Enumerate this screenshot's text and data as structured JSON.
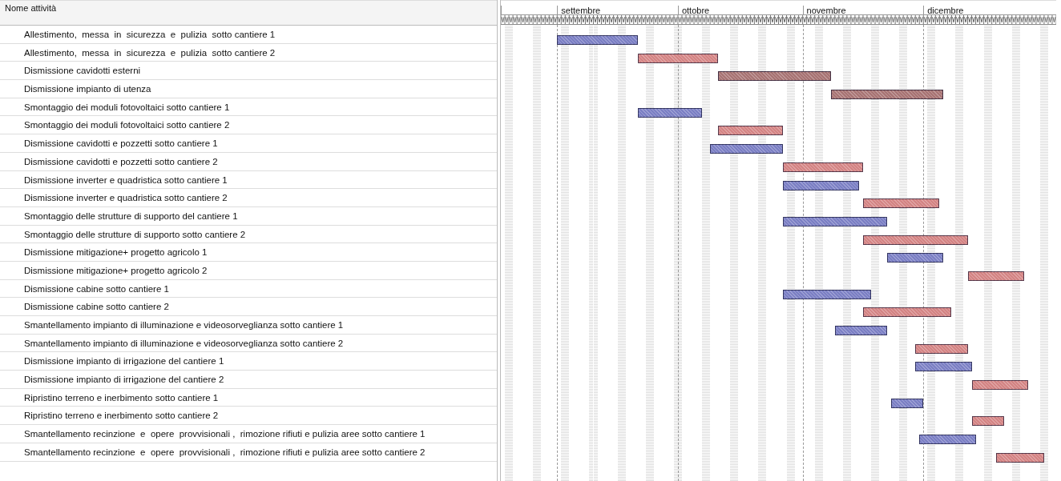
{
  "table": {
    "column_header": "Nome attività"
  },
  "timeline": {
    "months": [
      {
        "label": "settembre"
      },
      {
        "label": "ottobre"
      },
      {
        "label": "novembre"
      },
      {
        "label": "dicembre"
      }
    ]
  },
  "tasks": [
    {
      "name": "Allestimento,  messa  in  sicurezza  e  pulizia  sotto cantiere 1",
      "color": "#7b7fc4"
    },
    {
      "name": "Allestimento,  messa  in  sicurezza  e  pulizia  sotto cantiere 2",
      "color": "#d48484"
    },
    {
      "name": "Dismissione cavidotti esterni",
      "color": "#a87474"
    },
    {
      "name": "Dismissione impianto di utenza",
      "color": "#a87474"
    },
    {
      "name": "Smontaggio dei moduli fotovoltaici sotto cantiere 1",
      "color": "#7b7fc4"
    },
    {
      "name": "Smontaggio dei moduli fotovoltaici sotto cantiere 2",
      "color": "#d48484"
    },
    {
      "name": "Dismissione cavidotti e pozzetti sotto cantiere 1",
      "color": "#7b7fc4"
    },
    {
      "name": "Dismissione cavidotti e pozzetti sotto cantiere 2",
      "color": "#d48484"
    },
    {
      "name": "Dismissione inverter e quadristica sotto cantiere 1",
      "color": "#7b7fc4"
    },
    {
      "name": "Dismissione inverter e quadristica sotto cantiere 2",
      "color": "#d48484"
    },
    {
      "name": "Smontaggio delle strutture di supporto del cantiere 1",
      "color": "#7b7fc4"
    },
    {
      "name": "Smontaggio delle strutture di supporto sotto cantiere 2",
      "color": "#d48484"
    },
    {
      "name": "Dismissione mitigazione+ progetto agricolo 1",
      "color": "#7b7fc4"
    },
    {
      "name": "Dismissione mitigazione+ progetto agricolo 2",
      "color": "#d48484"
    },
    {
      "name": "Dismissione cabine sotto cantiere 1",
      "color": "#7b7fc4"
    },
    {
      "name": "Dismissione cabine sotto cantiere 2",
      "color": "#d48484"
    },
    {
      "name": "Smantellamento impianto di illuminazione e videosorveglianza sotto cantiere 1",
      "color": "#7b7fc4"
    },
    {
      "name": "Smantellamento impianto di illuminazione e videosorveglianza sotto cantiere 2",
      "color": "#d48484"
    },
    {
      "name": "Dismissione impianto di irrigazione del cantiere 1",
      "color": "#7b7fc4"
    },
    {
      "name": "Dismissione impianto di irrigazione del cantiere 2",
      "color": "#d48484"
    },
    {
      "name": "Ripristino terreno e inerbimento sotto cantiere 1",
      "color": "#7b7fc4"
    },
    {
      "name": "Ripristino terreno e inerbimento sotto cantiere 2",
      "color": "#d48484"
    },
    {
      "name": "Smantellamento recinzione  e  opere  provvisionali ,  rimozione rifiuti e pulizia aree sotto cantiere 1",
      "color": "#7b7fc4"
    },
    {
      "name": "Smantellamento recinzione  e  opere  provvisionali ,  rimozione rifiuti e pulizia aree sotto cantiere 2",
      "color": "#d48484"
    }
  ]
}
